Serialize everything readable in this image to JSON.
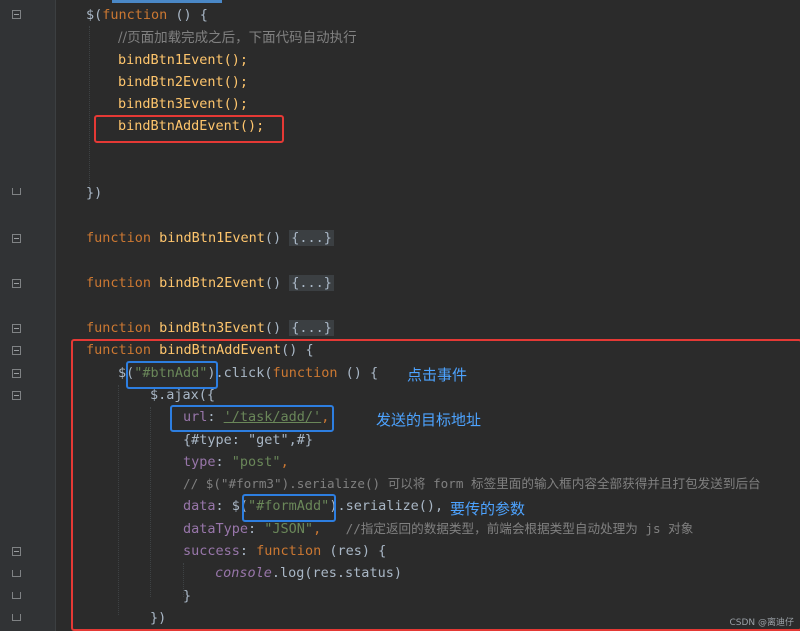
{
  "code": {
    "l1": {
      "a": "$(",
      "b": "function",
      "c": " () {"
    },
    "l2": "//页面加载完成之后，下面代码自动执行",
    "l3": "bindBtn1Event();",
    "l4": "bindBtn2Event();",
    "l5": "bindBtn3Event();",
    "l6": "bindBtnAddEvent();",
    "l7": "})",
    "f1": {
      "kw": "function",
      "name": "bindBtn1Event",
      "paren": "()",
      "collapsed": "{...}"
    },
    "f2": {
      "kw": "function",
      "name": "bindBtn2Event",
      "paren": "()",
      "collapsed": "{...}"
    },
    "f3": {
      "kw": "function",
      "name": "bindBtn3Event",
      "paren": "()",
      "collapsed": "{...}"
    },
    "f4": {
      "kw": "function",
      "name": "bindBtnAddEvent",
      "rest": "() {"
    },
    "click": {
      "a": "$(",
      "sel": "\"#btnAdd\"",
      "b": ").click(",
      "kw": "function",
      "c": " () {"
    },
    "ajax": "$.ajax({",
    "url": {
      "key": "url",
      "colon": ": ",
      "val": "'/task/add/'",
      "comma": ","
    },
    "type_comment": "{#type: \"get\",#}",
    "type": {
      "key": "type",
      "colon": ": ",
      "val": "\"post\"",
      "comma": ","
    },
    "serialize_comment": "// $(\"#form3\").serialize() 可以将 form 标签里面的输入框内容全部获得并且打包发送到后台",
    "data": {
      "key": "data",
      "a": ": $(",
      "sel": "\"#formAdd\"",
      "b": ").serialize(),"
    },
    "datatype": {
      "key": "dataType",
      "colon": ": ",
      "val": "\"JSON\"",
      "comma": ",",
      "comment": "//指定返回的数据类型，前端会根据类型自动处理为 js 对象"
    },
    "success": {
      "key": "success",
      "colon": ": ",
      "kw": "function",
      "rest": " (res) {"
    },
    "console": {
      "obj": "console",
      "rest": ".log(res.status)"
    },
    "close1": "}",
    "close2": "})"
  },
  "annotations": {
    "click_event": "点击事件",
    "target_url": "发送的目标地址",
    "params": "要传的参数"
  },
  "watermark": "CSDN @离迪仔",
  "colors": {
    "highlight_red": "#e53935",
    "highlight_blue": "#2d7ee0",
    "annotation": "#4da3ff"
  }
}
